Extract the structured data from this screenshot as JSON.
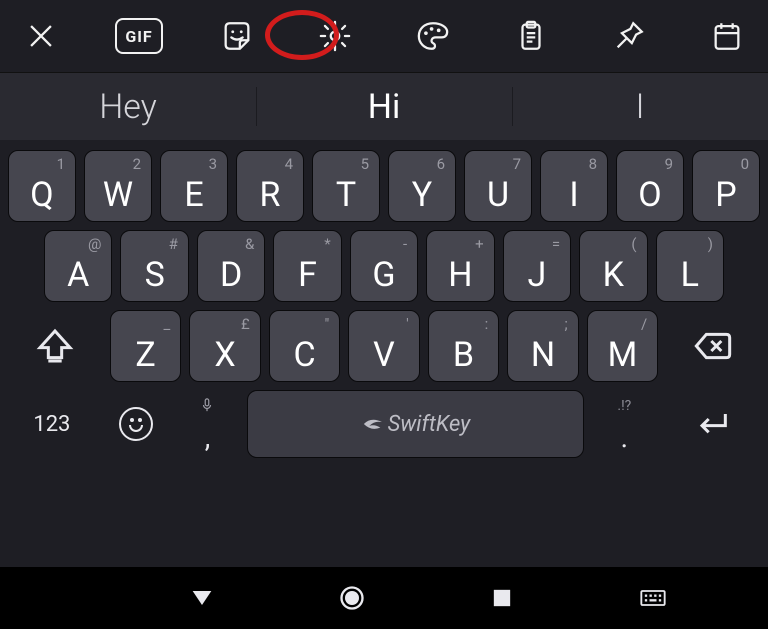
{
  "toolbar": {
    "gif_label": "GIF",
    "highlighted": "settings"
  },
  "suggestions": {
    "left": "Hey",
    "center": "Hi",
    "right": "I"
  },
  "keys": {
    "row1": [
      {
        "main": "Q",
        "alt": "1"
      },
      {
        "main": "W",
        "alt": "2"
      },
      {
        "main": "E",
        "alt": "3"
      },
      {
        "main": "R",
        "alt": "4"
      },
      {
        "main": "T",
        "alt": "5"
      },
      {
        "main": "Y",
        "alt": "6"
      },
      {
        "main": "U",
        "alt": "7"
      },
      {
        "main": "I",
        "alt": "8"
      },
      {
        "main": "O",
        "alt": "9"
      },
      {
        "main": "P",
        "alt": "0"
      }
    ],
    "row2": [
      {
        "main": "A",
        "alt": "@"
      },
      {
        "main": "S",
        "alt": "#"
      },
      {
        "main": "D",
        "alt": "&"
      },
      {
        "main": "F",
        "alt": "*"
      },
      {
        "main": "G",
        "alt": "-"
      },
      {
        "main": "H",
        "alt": "+"
      },
      {
        "main": "J",
        "alt": "="
      },
      {
        "main": "K",
        "alt": "("
      },
      {
        "main": "L",
        "alt": ")"
      }
    ],
    "row3": [
      {
        "main": "Z",
        "alt": "_"
      },
      {
        "main": "X",
        "alt": "£"
      },
      {
        "main": "C",
        "alt": "\""
      },
      {
        "main": "V",
        "alt": "'"
      },
      {
        "main": "B",
        "alt": ":"
      },
      {
        "main": "N",
        "alt": ";"
      },
      {
        "main": "M",
        "alt": "/"
      }
    ]
  },
  "bottom": {
    "symbols_label": "123",
    "comma_top": "🎤",
    "comma_bottom": ",",
    "space_label": "SwiftKey",
    "dot_top": ".!?",
    "dot_bottom": "."
  }
}
